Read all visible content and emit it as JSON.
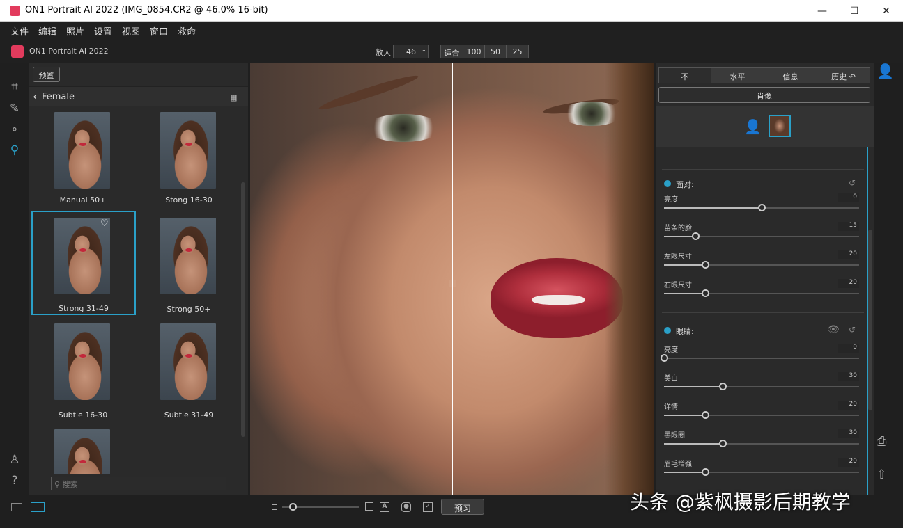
{
  "window": {
    "title": "ON1 Portrait AI 2022 (IMG_0854.CR2 @ 46.0% 16-bit)"
  },
  "menu": [
    "文件",
    "编辑",
    "照片",
    "设置",
    "视图",
    "窗口",
    "救命"
  ],
  "app": {
    "name": "ON1 Portrait AI 2022"
  },
  "zoom": {
    "label": "放大",
    "value": "46",
    "buttons": [
      "适合",
      "100",
      "50",
      "25"
    ]
  },
  "presets": {
    "button": "预置",
    "category": "Female",
    "items": [
      {
        "label": "Manual 50+"
      },
      {
        "label": "Stong 16-30"
      },
      {
        "label": "Strong 31-49"
      },
      {
        "label": "Strong 50+"
      },
      {
        "label": "Subtle 16-30"
      },
      {
        "label": "Subtle 31-49"
      }
    ],
    "search_placeholder": "搜索"
  },
  "right": {
    "tabs": [
      "不",
      "水平",
      "信息",
      "历史"
    ],
    "portrait": "肖像",
    "face_section": {
      "title": "面对:",
      "sliders": [
        {
          "label": "亮度",
          "value": "0",
          "pos": 0.5
        },
        {
          "label": "苗条的脸",
          "value": "15",
          "pos": 0.16
        },
        {
          "label": "左眼尺寸",
          "value": "20",
          "pos": 0.21
        },
        {
          "label": "右眼尺寸",
          "value": "20",
          "pos": 0.21
        }
      ]
    },
    "eyes_section": {
      "title": "眼睛:",
      "sliders": [
        {
          "label": "亮度",
          "value": "0",
          "pos": 0.0
        },
        {
          "label": "美白",
          "value": "30",
          "pos": 0.3
        },
        {
          "label": "详情",
          "value": "20",
          "pos": 0.21
        },
        {
          "label": "黑眼圈",
          "value": "30",
          "pos": 0.3
        },
        {
          "label": "眉毛增强",
          "value": "20",
          "pos": 0.21
        }
      ]
    }
  },
  "bottom": {
    "preview": "预习"
  },
  "watermark": "头条 @紫枫摄影后期教学",
  "colors": {
    "accent": "#2aa0c8",
    "brand": "#e23b5d"
  }
}
